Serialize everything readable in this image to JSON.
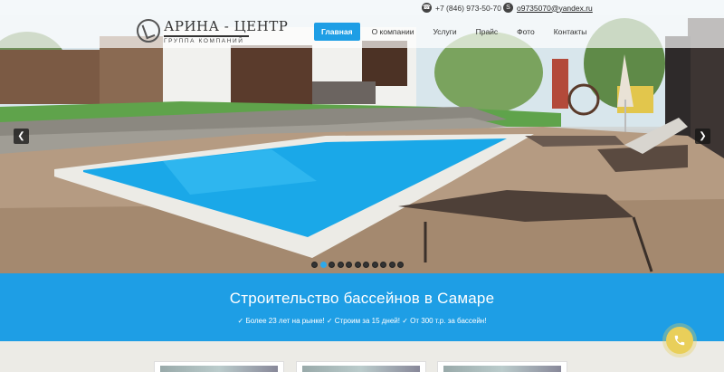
{
  "topbar": {
    "phone": "+7 (846) 973-50-70",
    "email": "o9735070@yandex.ru",
    "phone_icon": "phone-icon",
    "email_icon": "skype-icon"
  },
  "logo": {
    "name": "АРИНА - ЦЕНТР",
    "subtitle": "ГРУППА КОМПАНИЙ"
  },
  "nav": {
    "items": [
      {
        "label": "Главная",
        "active": true
      },
      {
        "label": "О компании"
      },
      {
        "label": "Услуги"
      },
      {
        "label": "Прайс"
      },
      {
        "label": "Фото"
      },
      {
        "label": "Контакты"
      }
    ]
  },
  "carousel": {
    "prev_icon": "chevron-left-icon",
    "next_icon": "chevron-right-icon",
    "slide_count": 11,
    "active_index": 1
  },
  "banner": {
    "title": "Строительство бассейнов в Самаре",
    "features": "✓ Более 23 лет на рынке!  ✓ Строим за 15 дней!  ✓ От 300 т.р. за бассейн!"
  },
  "colors": {
    "accent": "#1e9ee5",
    "call_button": "#e9cf5a"
  }
}
